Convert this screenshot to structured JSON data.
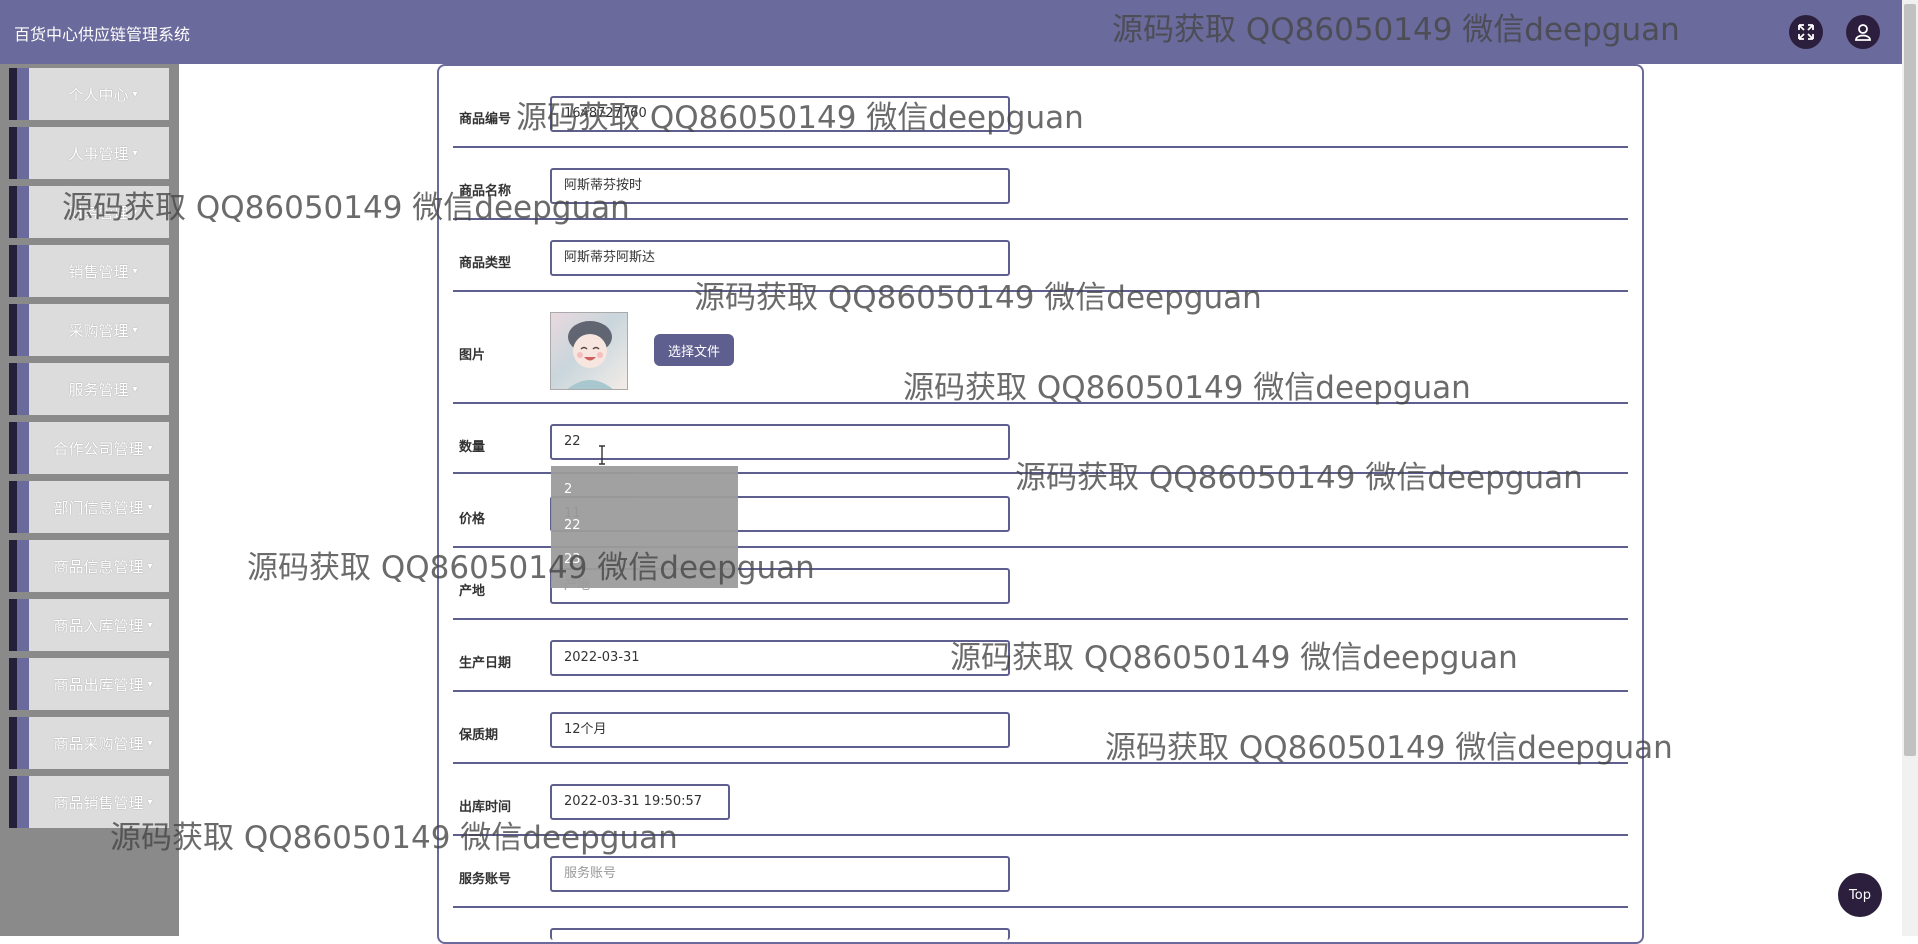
{
  "app": {
    "title": "百货中心供应链管理系统"
  },
  "header_icons": [
    "fullscreen-icon",
    "user-icon"
  ],
  "sidebar": {
    "items": [
      {
        "label": "个人中心"
      },
      {
        "label": "人事管理"
      },
      {
        "label": "财务管理"
      },
      {
        "label": "销售管理"
      },
      {
        "label": "采购管理"
      },
      {
        "label": "服务管理"
      },
      {
        "label": "合作公司管理"
      },
      {
        "label": "部门信息管理"
      },
      {
        "label": "商品信息管理"
      },
      {
        "label": "商品入库管理"
      },
      {
        "label": "商品出库管理"
      },
      {
        "label": "商品采购管理"
      },
      {
        "label": "商品销售管理"
      }
    ]
  },
  "form": {
    "product_code": {
      "label": "商品编号",
      "value": "1648727760"
    },
    "product_name": {
      "label": "商品名称",
      "value": "阿斯蒂芬按时"
    },
    "product_type": {
      "label": "商品类型",
      "value": "阿斯蒂芬阿斯达"
    },
    "image": {
      "label": "图片",
      "button": "选择文件"
    },
    "quantity": {
      "label": "数量",
      "value": "22"
    },
    "price": {
      "label": "价格",
      "value": "11"
    },
    "origin": {
      "label": "产地",
      "placeholder": "产地"
    },
    "production_date": {
      "label": "生产日期",
      "value": "2022-03-31"
    },
    "shelf_life": {
      "label": "保质期",
      "value": "12个月"
    },
    "outbound_time": {
      "label": "出库时间",
      "value": "2022-03-31 19:50:57"
    },
    "service_account": {
      "label": "服务账号",
      "placeholder": "服务账号"
    }
  },
  "autocomplete": {
    "options": [
      "2",
      "22",
      "23"
    ]
  },
  "top_button": "Top",
  "watermark": "源码获取 QQ86050149 微信deepguan",
  "colors": {
    "header": "#6a6a9c",
    "accent": "#5f5f8f",
    "dark": "#2c1f3d",
    "sidebar": "#8a8a8a"
  }
}
